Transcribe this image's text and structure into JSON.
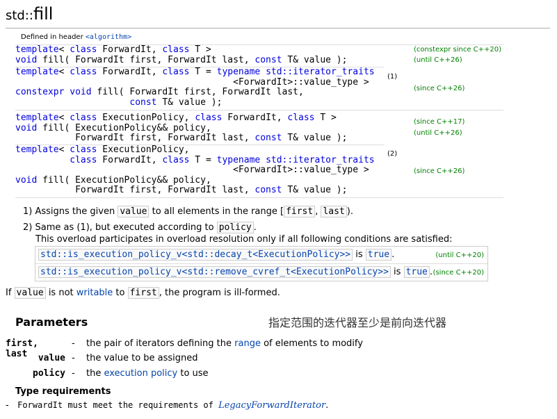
{
  "title": {
    "ns": "std::",
    "name": "fill"
  },
  "defined_in": {
    "prefix": "Defined in header ",
    "header": "<algorithm>"
  },
  "declarations": [
    {
      "lines": [
        "template< class ForwardIt, class T >",
        "void fill( ForwardIt first, ForwardIt last, const T& value );"
      ],
      "since": [
        "(constexpr since C++20)",
        "(until C++26)"
      ]
    },
    {
      "lines": [
        "template< class ForwardIt, class T = typename std::iterator_traits",
        "                                        <ForwardIt>::value_type >",
        "constexpr void fill( ForwardIt first, ForwardIt last,",
        "                     const T& value );"
      ],
      "since": [
        "(since C++26)"
      ],
      "num": "(1)"
    },
    {
      "lines": [
        "template< class ExecutionPolicy, class ForwardIt, class T >",
        "void fill( ExecutionPolicy&& policy,",
        "           ForwardIt first, ForwardIt last, const T& value );"
      ],
      "since": [
        "(since C++17)",
        "(until C++26)"
      ]
    },
    {
      "lines": [
        "template< class ExecutionPolicy,",
        "          class ForwardIt, class T = typename std::iterator_traits",
        "                                        <ForwardIt>::value_type >",
        "void fill( ExecutionPolicy&& policy,",
        "           ForwardIt first, ForwardIt last, const T& value );"
      ],
      "since": [
        "(since C++26)"
      ],
      "num": "(2)"
    }
  ],
  "description": {
    "item1": {
      "pre": "1) Assigns the given ",
      "code1": "value",
      "mid": " to all elements in the range [",
      "code2": "first",
      "sep": ", ",
      "code3": "last",
      "post": ")."
    },
    "item2": {
      "pre": "2) Same as (1), but executed according to ",
      "code": "policy",
      "post": "."
    },
    "overload": "This overload participates in overload resolution only if all following conditions are satisfied:",
    "conditions": [
      {
        "expr": "std::is_execution_policy_v<std::decay_t<ExecutionPolicy>>",
        "is": " is ",
        "val": "true",
        "dot": ".",
        "label": "(until C++20)"
      },
      {
        "expr": "std::is_execution_policy_v<std::remove_cvref_t<ExecutionPolicy>>",
        "is": " is ",
        "val": "true",
        "dot": ".",
        "label": "(since C++20)"
      }
    ]
  },
  "ill_formed": {
    "pre": "If ",
    "code1": "value",
    "mid1": " is not ",
    "link": "writable",
    "mid2": " to ",
    "code2": "first",
    "post": ", the program is ill-formed."
  },
  "parameters": {
    "heading": "Parameters",
    "note": "指定范围的迭代器至少是前向迭代器",
    "items": [
      {
        "name": "first, last",
        "dash": "-",
        "pre": "the pair of iterators defining the ",
        "link": "range",
        "post": " of elements to modify"
      },
      {
        "name": "value",
        "dash": "-",
        "pre": "the value to be assigned",
        "link": "",
        "post": ""
      },
      {
        "name": "policy",
        "dash": "-",
        "pre": "the ",
        "link": "execution policy",
        "post": " to use"
      }
    ]
  },
  "type_requirements": {
    "heading": "Type requirements",
    "dash": "-",
    "pre": "ForwardIt must meet the requirements of ",
    "link": "LegacyForwardIterator",
    "post": "."
  }
}
